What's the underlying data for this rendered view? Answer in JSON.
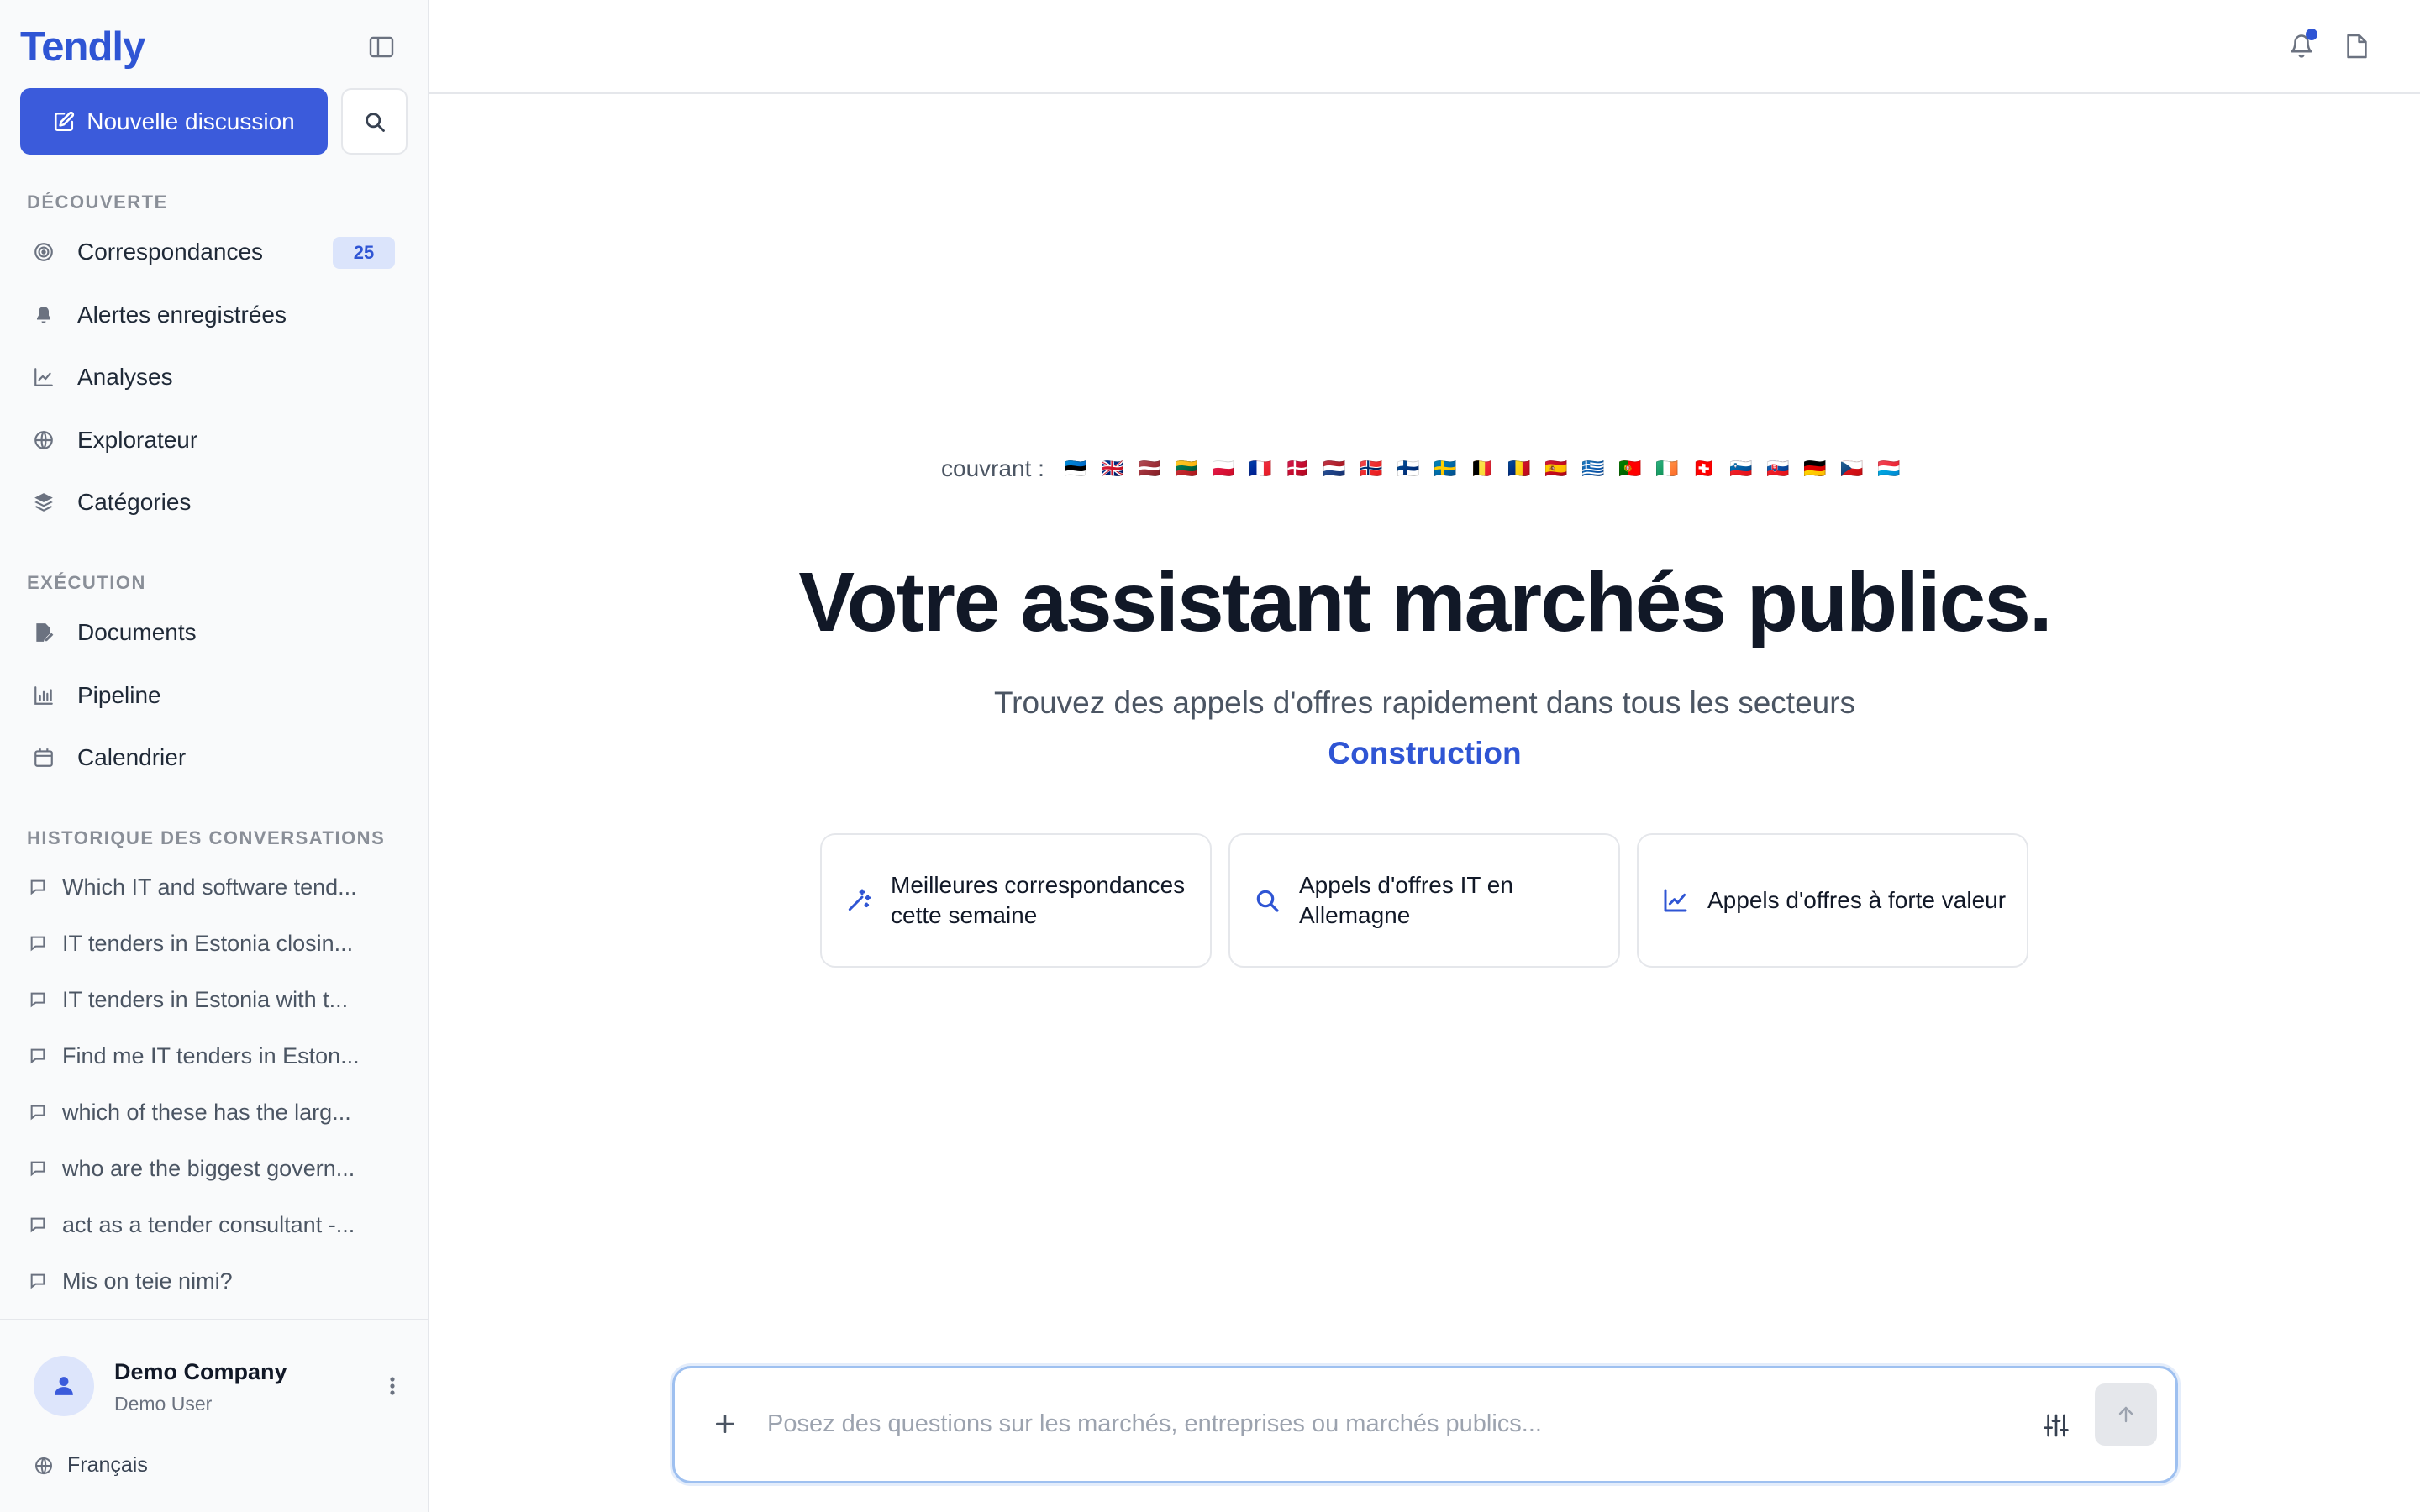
{
  "app": {
    "name": "Tendly"
  },
  "sidebar": {
    "new_chat_label": "Nouvelle discussion",
    "sections": {
      "discovery": "DÉCOUVERTE",
      "execution": "EXÉCUTION",
      "history": "HISTORIQUE DES CONVERSATIONS"
    },
    "discovery_items": [
      {
        "label": "Correspondances",
        "icon": "target-icon",
        "badge": "25"
      },
      {
        "label": "Alertes enregistrées",
        "icon": "bell-icon"
      },
      {
        "label": "Analyses",
        "icon": "chart-line-icon"
      },
      {
        "label": "Explorateur",
        "icon": "globe-icon"
      },
      {
        "label": "Catégories",
        "icon": "layers-icon"
      }
    ],
    "execution_items": [
      {
        "label": "Documents",
        "icon": "file-edit-icon"
      },
      {
        "label": "Pipeline",
        "icon": "bar-chart-icon"
      },
      {
        "label": "Calendrier",
        "icon": "calendar-icon"
      }
    ],
    "history": [
      "Which IT and software tend...",
      "IT tenders in Estonia closin...",
      "IT tenders in Estonia with t...",
      "Find me IT tenders in Eston...",
      "which of these has the larg...",
      "who are the biggest govern...",
      "act as a tender consultant -...",
      "Mis on teie nimi?"
    ],
    "user": {
      "company": "Demo Company",
      "name": "Demo User"
    },
    "language": "Français"
  },
  "main": {
    "covering_label": "couvrant :",
    "flags": [
      "🇪🇪",
      "🇬🇧",
      "🇱🇻",
      "🇱🇹",
      "🇵🇱",
      "🇫🇷",
      "🇩🇰",
      "🇳🇱",
      "🇳🇴",
      "🇫🇮",
      "🇸🇪",
      "🇧🇪",
      "🇷🇴",
      "🇪🇸",
      "🇬🇷",
      "🇵🇹",
      "🇮🇪",
      "🇨🇭",
      "🇸🇮",
      "🇸🇰",
      "🇩🇪",
      "🇨🇿",
      "🇱🇺"
    ],
    "headline": "Votre assistant marchés publics.",
    "subheadline": "Trouvez des appels d'offres rapidement dans tous les secteurs",
    "rotating_sector": "Construction",
    "suggestions": [
      {
        "label": "Meilleures correspondances cette semaine",
        "icon": "magic-wand-icon"
      },
      {
        "label": "Appels d'offres IT en Allemagne",
        "icon": "search-icon"
      },
      {
        "label": "Appels d'offres à forte valeur",
        "icon": "trending-up-icon"
      }
    ],
    "composer": {
      "placeholder": "Posez des questions sur les marchés, entreprises ou marchés publics...",
      "value": ""
    }
  },
  "colors": {
    "brand": "#2f55d4",
    "primary_button": "#3b5bdb",
    "badge_bg": "#dbe4fb",
    "notification_dot": "#2f55d4"
  }
}
